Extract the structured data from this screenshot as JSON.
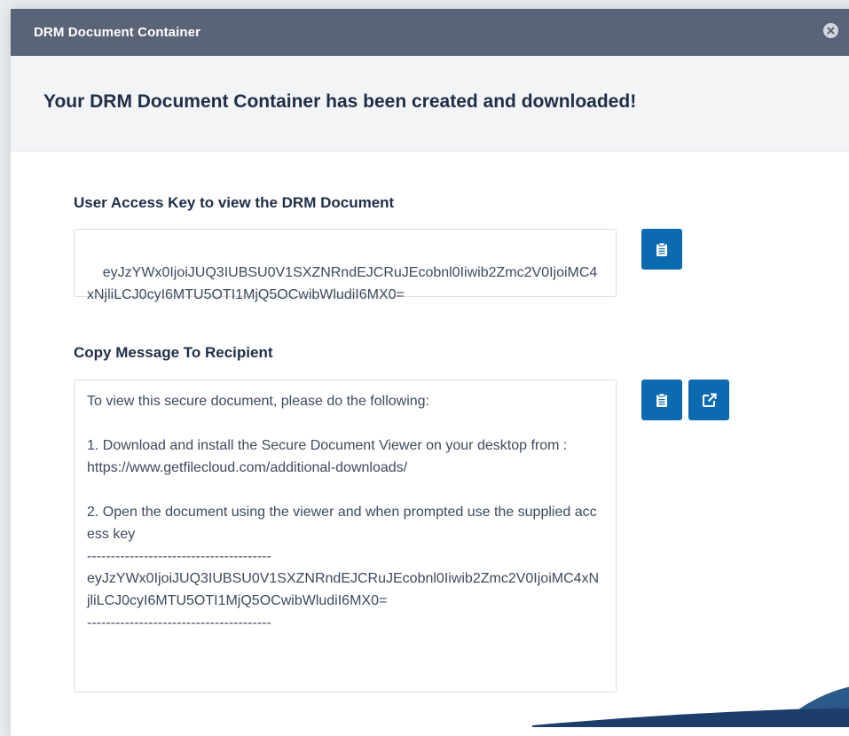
{
  "dialog": {
    "title": "DRM Document Container",
    "close_icon": "close-circle-icon"
  },
  "banner": {
    "text": "Your DRM Document Container has been created and downloaded!"
  },
  "access_key": {
    "label": "User Access Key to view the DRM Document",
    "value": "eyJzYWx0IjoiJUQ3IUBSU0V1SXZNRndEJCRuJEcobnl0Iiwib2Zmc2V0IjoiMC4xNjliLCJ0cyI6MTU5OTI1MjQ5OCwibWludiI6MX0=",
    "copy_icon": "clipboard-icon"
  },
  "message": {
    "label": "Copy Message To Recipient",
    "lines": [
      "To view this secure document, please do the following:",
      "",
      "1. Download and install the Secure Document Viewer on your desktop from :",
      "https://www.getfilecloud.com/additional-downloads/",
      "",
      "2. Open the document using the viewer and when prompted use the supplied access key",
      "---------------------------------------",
      "eyJzYWx0IjoiJUQ3IUBSU0V1SXZNRndEJCRuJEcobnl0Iiwib2Zmc2V0IjoiMC4xNjliLCJ0cyI6MTU5OTI1MjQ5OCwibWludiI6MX0=",
      "---------------------------------------"
    ],
    "copy_icon": "clipboard-icon",
    "open_icon": "external-link-icon"
  },
  "colors": {
    "header_bg": "#5a6478",
    "accent": "#0b6ab0",
    "heading_text": "#1f2d47"
  }
}
